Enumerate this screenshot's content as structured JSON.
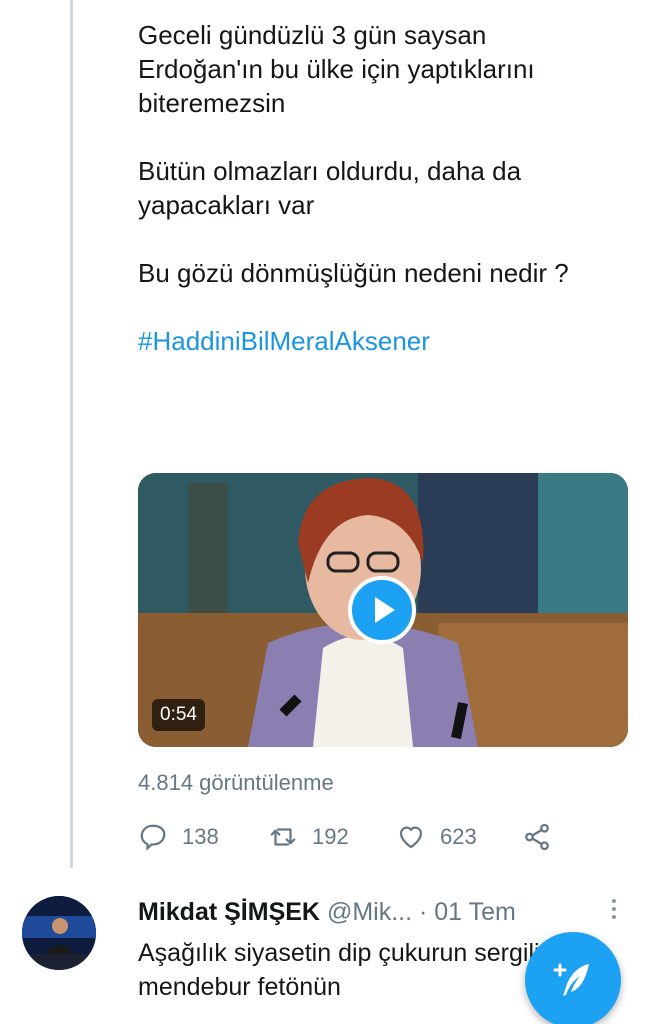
{
  "tweet": {
    "lines": [
      "Geceli gündüzlü 3 gün saysan Erdoğan'ın bu ülke için yaptıklarını biteremezsin",
      "Bütün olmazları oldurdu, daha da yapacakları var",
      "Bu gözü dönmüşlüğün nedeni nedir ?"
    ],
    "hashtag": "#HaddiniBilMeralAksener",
    "video": {
      "duration": "0:54",
      "play_icon": "play-icon"
    },
    "views": "4.814 görüntülenme",
    "actions": {
      "reply_count": "138",
      "retweet_count": "192",
      "like_count": "623"
    }
  },
  "reply": {
    "name": "Mikdat ŞİMŞEK",
    "handle": "@Mik...",
    "separator": "·",
    "date": "01 Tem",
    "text": "Aşağılık siyasetin dip çukurun sergiliyor mendebur fetönün"
  },
  "colors": {
    "accent": "#1da1f2",
    "hashtag": "#1b95e0",
    "secondary_text": "#657786",
    "thread_line": "#cfd9de"
  },
  "fab": {
    "icon": "compose-tweet-icon"
  }
}
